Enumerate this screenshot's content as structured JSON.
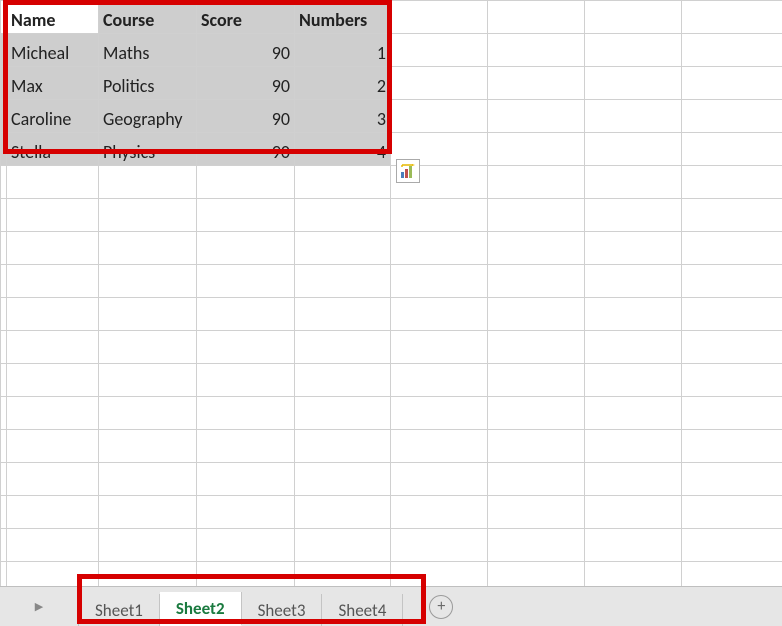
{
  "grid": {
    "headers": [
      "Name",
      "Course",
      "Score",
      "Numbers"
    ],
    "rows": [
      {
        "name": "Micheal",
        "course": "Maths",
        "score": 90,
        "numbers": 1
      },
      {
        "name": "Max",
        "course": "Politics",
        "score": 90,
        "numbers": 2
      },
      {
        "name": "Caroline",
        "course": "Geography",
        "score": 90,
        "numbers": 3
      },
      {
        "name": "Stella",
        "course": "Physics",
        "score": 90,
        "numbers": 4
      }
    ]
  },
  "tabs": {
    "items": [
      {
        "label": "Sheet1",
        "active": false
      },
      {
        "label": "Sheet2",
        "active": true
      },
      {
        "label": "Sheet3",
        "active": false
      },
      {
        "label": "Sheet4",
        "active": false
      }
    ]
  },
  "chart_data": {
    "type": "table",
    "title": "",
    "columns": [
      "Name",
      "Course",
      "Score",
      "Numbers"
    ],
    "rows": [
      [
        "Micheal",
        "Maths",
        90,
        1
      ],
      [
        "Max",
        "Politics",
        90,
        2
      ],
      [
        "Caroline",
        "Geography",
        90,
        3
      ],
      [
        "Stella",
        "Physics",
        90,
        4
      ]
    ]
  }
}
